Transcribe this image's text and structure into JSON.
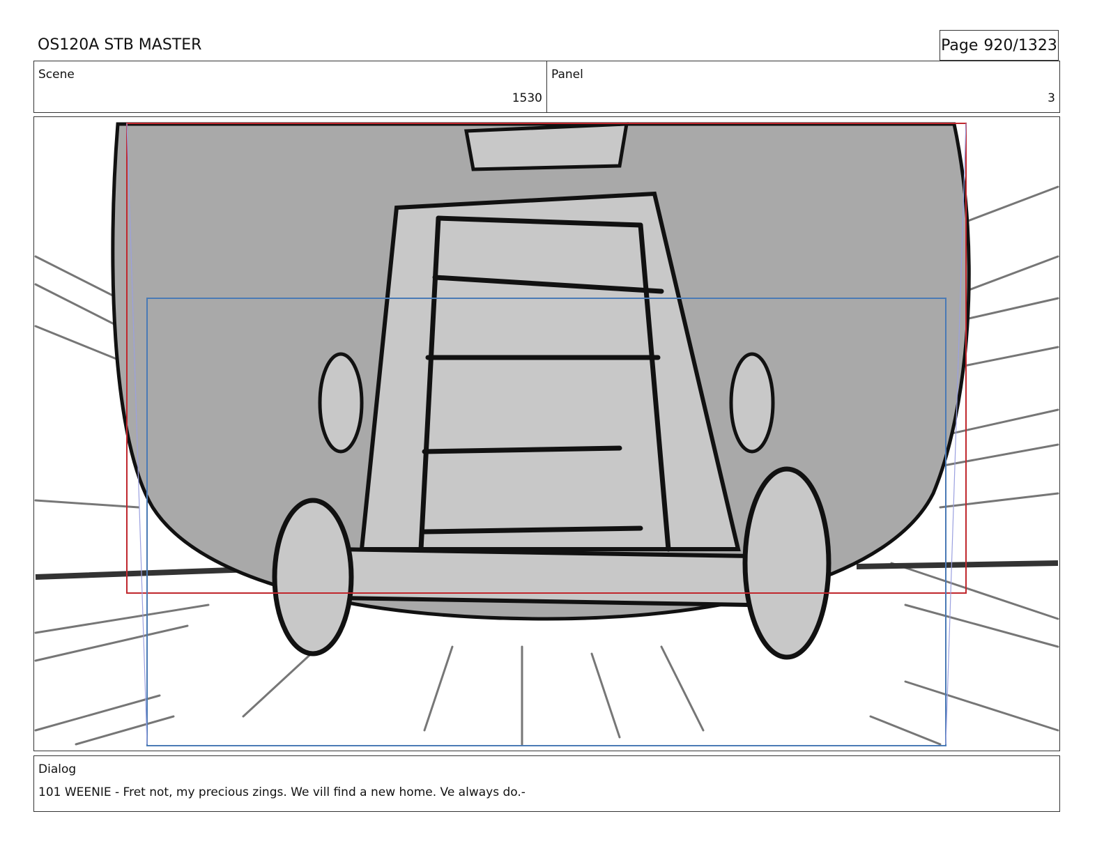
{
  "document": {
    "title": "OS120A STB MASTER",
    "page_label": "Page",
    "page_number": "920/1323"
  },
  "scene": {
    "label": "Scene",
    "value": "1530"
  },
  "panel": {
    "label": "Panel",
    "value": "3"
  },
  "dialog": {
    "label": "Dialog",
    "text": "101 WEENIE - Fret not, my precious zings. We vill find a new home. Ve always do.-"
  },
  "frame_colors": {
    "red_frame": "#c0272d",
    "blue_frame": "#4a7ab5",
    "fill_gray": "#a9a9a9",
    "light_gray": "#c8c8c8"
  }
}
